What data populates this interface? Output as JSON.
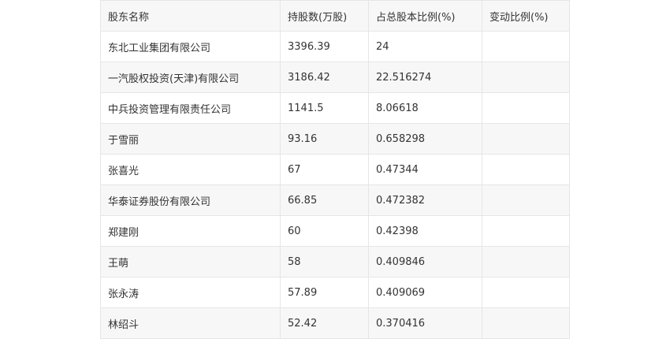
{
  "table": {
    "headers": [
      "股东名称",
      "持股数(万股)",
      "占总股本比例(%)",
      "变动比例(%)"
    ],
    "rows": [
      [
        "东北工业集团有限公司",
        "3396.39",
        "24",
        ""
      ],
      [
        "一汽股权投资(天津)有限公司",
        "3186.42",
        "22.516274",
        ""
      ],
      [
        "中兵投资管理有限责任公司",
        "1141.5",
        "8.06618",
        ""
      ],
      [
        "于雪丽",
        "93.16",
        "0.658298",
        ""
      ],
      [
        "张喜光",
        "67",
        "0.47344",
        ""
      ],
      [
        "华泰证券股份有限公司",
        "66.85",
        "0.472382",
        ""
      ],
      [
        "郑建刚",
        "60",
        "0.42398",
        ""
      ],
      [
        "王萌",
        "58",
        "0.409846",
        ""
      ],
      [
        "张永涛",
        "57.89",
        "0.409069",
        ""
      ],
      [
        "林绍斗",
        "52.42",
        "0.370416",
        ""
      ]
    ]
  }
}
